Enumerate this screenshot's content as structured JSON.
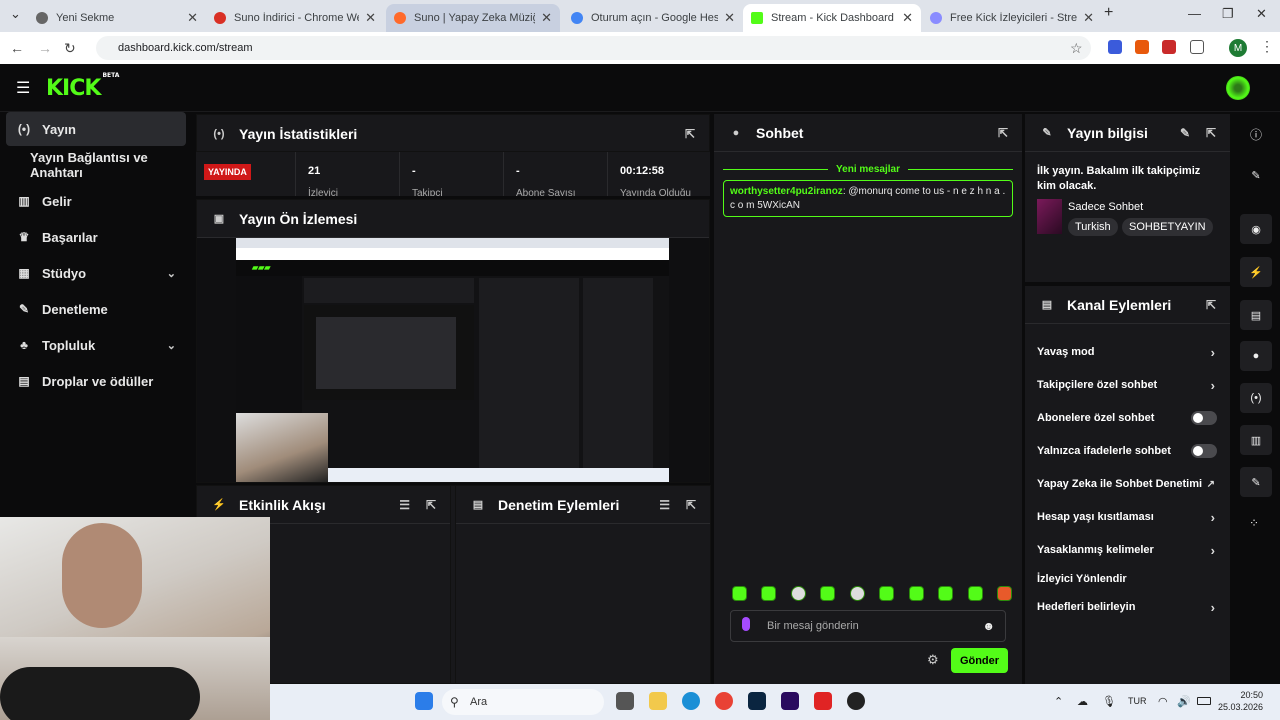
{
  "browser": {
    "tabs": [
      {
        "title": "Yeni Sekme",
        "fav_color": "#555555"
      },
      {
        "title": "Suno İndirici - Chrome Web M...",
        "fav_color": "#d93025"
      },
      {
        "title": "Suno | Yapay Zeka Müziği",
        "fav_color": "#ff6a2b"
      },
      {
        "title": "Oturum açın - Google Hesapları",
        "fav_color": "#4285f4"
      },
      {
        "title": "Stream - Kick Dashboard",
        "fav_color": "#53fc18"
      },
      {
        "title": "Free Kick İzleyicileri - Streamerv...",
        "fav_color": "#8a8cff"
      }
    ],
    "url": "dashboard.kick.com/stream",
    "profile_initial": "M"
  },
  "topbar": {
    "logo": "KICK",
    "logo_badge": "BETA"
  },
  "sidebar": {
    "items": [
      {
        "label": "Yayın",
        "icon": "broadcast-icon",
        "glyph": "(•)"
      },
      {
        "label": "Yayın Bağlantısı ve Anahtarı",
        "icon": "",
        "glyph": ""
      },
      {
        "label": "Gelir",
        "icon": "chart-icon",
        "glyph": "▥"
      },
      {
        "label": "Başarılar",
        "icon": "trophy-icon",
        "glyph": "🏆"
      },
      {
        "label": "Stüdyo",
        "icon": "studio-icon",
        "glyph": "▦"
      },
      {
        "label": "Denetleme",
        "icon": "wrench-icon",
        "glyph": "✎"
      },
      {
        "label": "Topluluk",
        "icon": "people-icon",
        "glyph": "👥"
      },
      {
        "label": "Droplar ve ödüller",
        "icon": "gift-icon",
        "glyph": "▤"
      }
    ]
  },
  "stats_panel": {
    "title": "Yayın İstatistikleri",
    "live_badge": "YAYINDA",
    "stats": [
      {
        "value": "21",
        "label": "İzleyici"
      },
      {
        "value": "-",
        "label": "Takipçi"
      },
      {
        "value": "-",
        "label": "Abone Sayısı"
      },
      {
        "value": "00:12:58",
        "label": "Yayında Olduğu"
      }
    ]
  },
  "preview_panel": {
    "title": "Yayın Ön İzlemesi"
  },
  "activity_panel": {
    "title": "Etkinlik Akışı"
  },
  "moderation_panel": {
    "title": "Denetim Eylemleri"
  },
  "chat": {
    "title": "Sohbet",
    "new_messages": "Yeni mesajlar",
    "messages": [
      {
        "user": "worthysetter4pu2iranoz",
        "text": ": @monurq come to us - n e z h n a . c o m 5WXicAN"
      }
    ],
    "input_placeholder": "Bir mesaj gönderin",
    "send_label": "Gönder"
  },
  "stream_info": {
    "title": "Yayın bilgisi",
    "stream_title": "İlk yayın. Bakalım ilk takipçimiz kim olacak.",
    "category": "Sadece Sohbet",
    "tags": [
      "Turkish",
      "SOHBETYAYIN"
    ]
  },
  "channel_actions": {
    "title": "Kanal Eylemleri",
    "items": [
      {
        "label": "Yavaş mod",
        "control": "chevron"
      },
      {
        "label": "Takipçilere özel sohbet",
        "control": "chevron"
      },
      {
        "label": "Abonelere özel sohbet",
        "control": "toggle"
      },
      {
        "label": "Yalnızca ifadelerle sohbet",
        "control": "toggle"
      },
      {
        "label": "Yapay Zeka ile Sohbet Denetimi",
        "control": "external"
      },
      {
        "label": "Hesap yaşı kısıtlaması",
        "control": "chevron"
      },
      {
        "label": "Yasaklanmış kelimeler",
        "control": "chevron"
      },
      {
        "label": "İzleyici Yönlendir",
        "control": "none"
      },
      {
        "label": "Hedefleri belirleyin",
        "control": "chevron"
      }
    ]
  },
  "taskbar": {
    "search_label": "Ara",
    "lang": "TUR",
    "time": "20:50",
    "date": "25.03.2026"
  },
  "colors": {
    "accent": "#53fc18",
    "live": "#d01818",
    "panel": "#18181b",
    "background": "#0b0b0c"
  }
}
